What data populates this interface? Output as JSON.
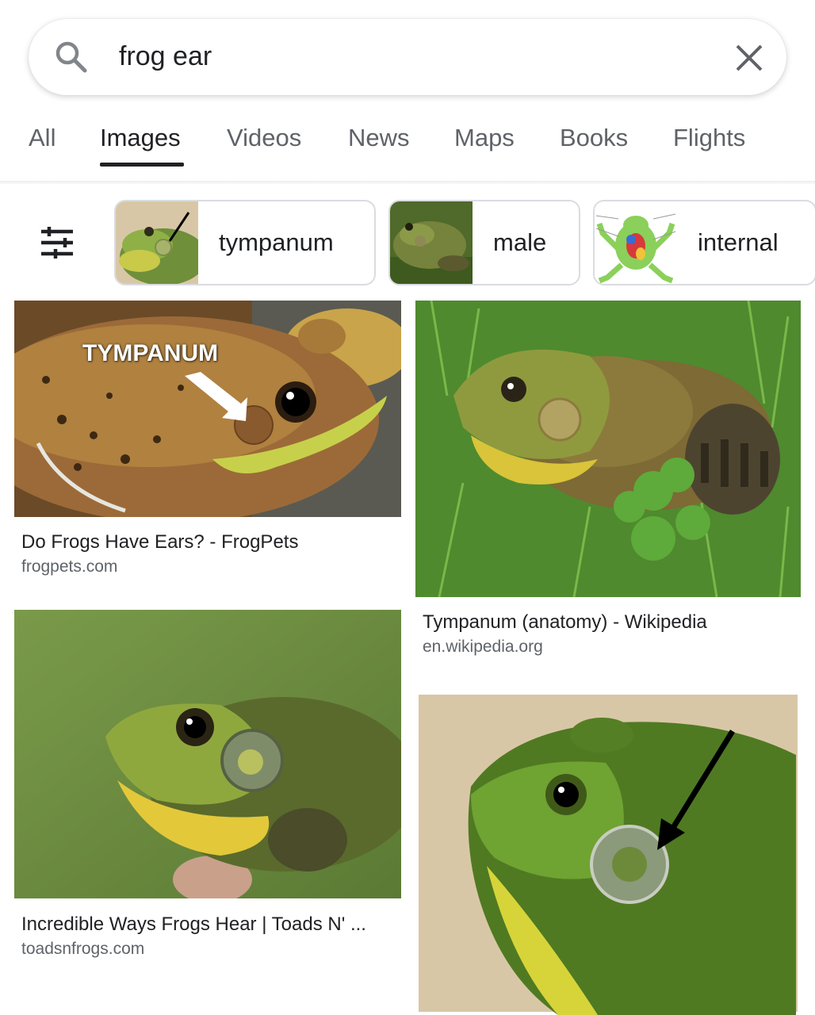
{
  "search": {
    "query": "frog ear"
  },
  "tabs": [
    {
      "label": "All"
    },
    {
      "label": "Images"
    },
    {
      "label": "Videos"
    },
    {
      "label": "News"
    },
    {
      "label": "Maps"
    },
    {
      "label": "Books"
    },
    {
      "label": "Flights"
    }
  ],
  "active_tab": "Images",
  "chips": [
    {
      "label": "tympanum"
    },
    {
      "label": "male"
    },
    {
      "label": "internal"
    }
  ],
  "results": [
    {
      "title": "Do Frogs Have Ears? - FrogPets",
      "source": "frogpets.com",
      "overlay": "TYMPANUM"
    },
    {
      "title": "Tympanum (anatomy) - Wikipedia",
      "source": "en.wikipedia.org"
    },
    {
      "title": "Incredible Ways Frogs Hear | Toads N' ...",
      "source": "toadsnfrogs.com"
    }
  ],
  "icons": {
    "search": "search-icon",
    "clear": "close-icon",
    "filters": "tune-icon"
  },
  "colors": {
    "text_primary": "#202124",
    "text_secondary": "#5f6368",
    "chip_border": "#dadce0"
  }
}
